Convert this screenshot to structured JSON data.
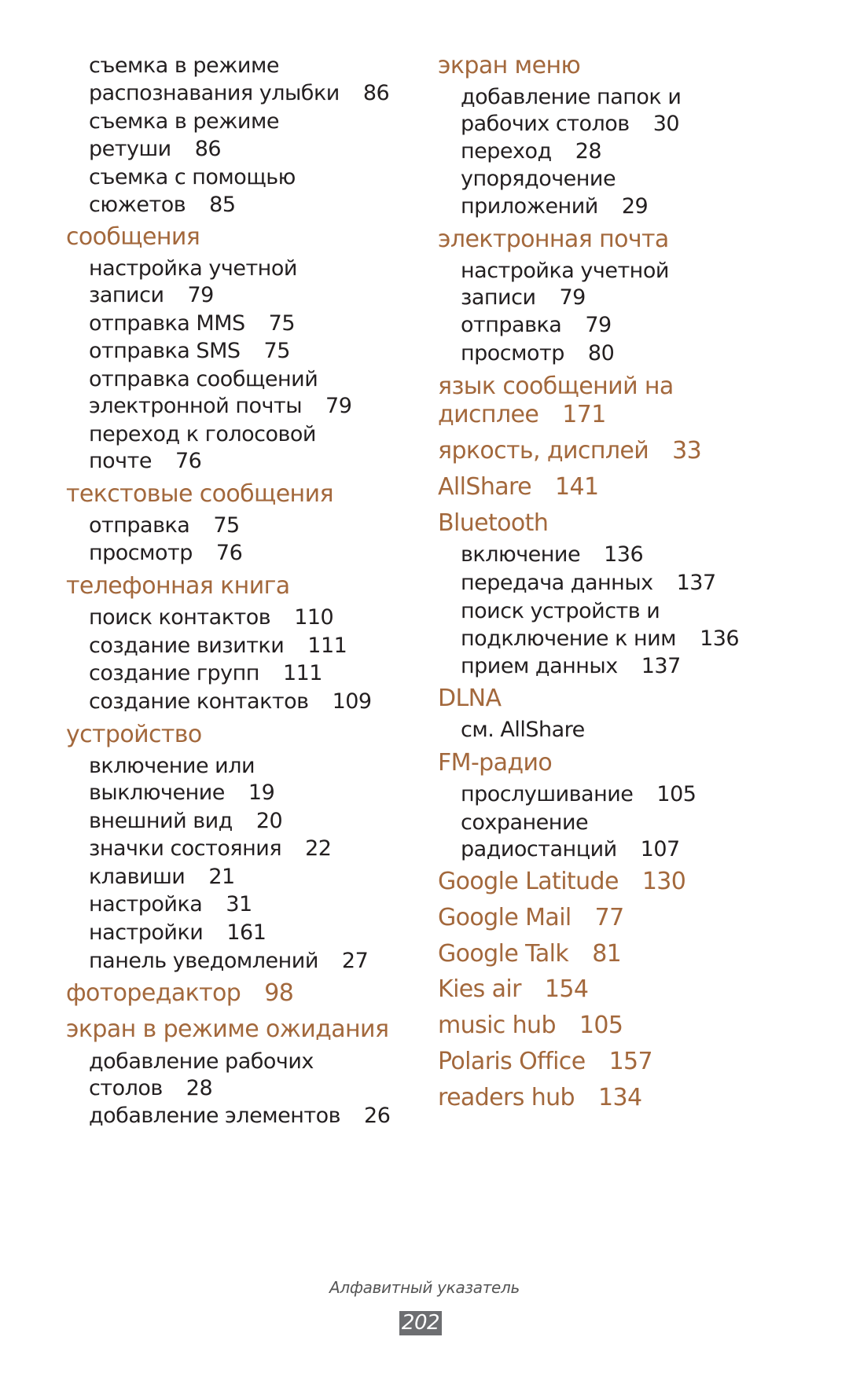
{
  "colors": {
    "heading": "#a3683c",
    "body": "#231f20",
    "footer": "#555555",
    "page_badge": "#6d6e71"
  },
  "left_column": [
    {
      "type": "sub",
      "text": "съемка в режиме",
      "page": ""
    },
    {
      "type": "sub",
      "text": "распознавания улыбки",
      "page": "86"
    },
    {
      "type": "sub",
      "text": "съемка в режиме",
      "page": ""
    },
    {
      "type": "sub",
      "text": "ретуши",
      "page": "86"
    },
    {
      "type": "sub",
      "text": "съемка с помощью",
      "page": ""
    },
    {
      "type": "sub",
      "text": "сюжетов",
      "page": "85"
    },
    {
      "type": "head",
      "text": "сообщения",
      "page": ""
    },
    {
      "type": "sub",
      "text": "настройка учетной",
      "page": ""
    },
    {
      "type": "sub",
      "text": "записи",
      "page": "79"
    },
    {
      "type": "sub",
      "text": "отправка MMS",
      "page": "75"
    },
    {
      "type": "sub",
      "text": "отправка SMS",
      "page": "75"
    },
    {
      "type": "sub",
      "text": "отправка сообщений",
      "page": ""
    },
    {
      "type": "sub",
      "text": "электронной почты",
      "page": "79"
    },
    {
      "type": "sub",
      "text": "переход к голосовой",
      "page": ""
    },
    {
      "type": "sub",
      "text": "почте",
      "page": "76"
    },
    {
      "type": "head",
      "text": "текстовые сообщения",
      "page": ""
    },
    {
      "type": "sub",
      "text": "отправка",
      "page": "75"
    },
    {
      "type": "sub",
      "text": "просмотр",
      "page": "76"
    },
    {
      "type": "head",
      "text": "телефонная книга",
      "page": ""
    },
    {
      "type": "sub",
      "text": "поиск контактов",
      "page": "110"
    },
    {
      "type": "sub",
      "text": "создание визитки",
      "page": "111"
    },
    {
      "type": "sub",
      "text": "создание групп",
      "page": "111"
    },
    {
      "type": "sub",
      "text": "создание контактов",
      "page": "109"
    },
    {
      "type": "head",
      "text": "устройство",
      "page": ""
    },
    {
      "type": "sub",
      "text": "включение или",
      "page": ""
    },
    {
      "type": "sub",
      "text": "выключение",
      "page": "19"
    },
    {
      "type": "sub",
      "text": "внешний вид",
      "page": "20"
    },
    {
      "type": "sub",
      "text": "значки состояния",
      "page": "22"
    },
    {
      "type": "sub",
      "text": "клавиши",
      "page": "21"
    },
    {
      "type": "sub",
      "text": "настройка",
      "page": "31"
    },
    {
      "type": "sub",
      "text": "настройки",
      "page": "161"
    },
    {
      "type": "sub",
      "text": "панель уведомлений",
      "page": "27"
    },
    {
      "type": "head",
      "text": "фоторедактор",
      "page": "98"
    },
    {
      "type": "head",
      "text": "экран в режиме ожидания",
      "page": ""
    },
    {
      "type": "sub",
      "text": "добавление рабочих",
      "page": ""
    },
    {
      "type": "sub",
      "text": "столов",
      "page": "28"
    },
    {
      "type": "sub",
      "text": "добавление элементов",
      "page": "26"
    }
  ],
  "right_column": [
    {
      "type": "head",
      "text": "экран меню",
      "page": ""
    },
    {
      "type": "sub",
      "text": "добавление папок и",
      "page": ""
    },
    {
      "type": "sub",
      "text": "рабочих столов",
      "page": "30"
    },
    {
      "type": "sub",
      "text": "переход",
      "page": "28"
    },
    {
      "type": "sub",
      "text": "упорядочение",
      "page": ""
    },
    {
      "type": "sub",
      "text": "приложений",
      "page": "29"
    },
    {
      "type": "head",
      "text": "электронная почта",
      "page": ""
    },
    {
      "type": "sub",
      "text": "настройка учетной",
      "page": ""
    },
    {
      "type": "sub",
      "text": "записи",
      "page": "79"
    },
    {
      "type": "sub",
      "text": "отправка",
      "page": "79"
    },
    {
      "type": "sub",
      "text": "просмотр",
      "page": "80"
    },
    {
      "type": "head",
      "text": "язык сообщений на",
      "page": ""
    },
    {
      "type": "head",
      "text": "дисплее",
      "page": "171"
    },
    {
      "type": "head",
      "text": "яркость, дисплей",
      "page": "33"
    },
    {
      "type": "head",
      "text": "AllShare",
      "page": "141"
    },
    {
      "type": "head",
      "text": "Bluetooth",
      "page": ""
    },
    {
      "type": "sub",
      "text": "включение",
      "page": "136"
    },
    {
      "type": "sub",
      "text": "передача данных",
      "page": "137"
    },
    {
      "type": "sub",
      "text": "поиск устройств и",
      "page": ""
    },
    {
      "type": "sub",
      "text": "подключение к ним",
      "page": "136"
    },
    {
      "type": "sub",
      "text": "прием данных",
      "page": "137"
    },
    {
      "type": "head",
      "text": "DLNA",
      "page": ""
    },
    {
      "type": "sub",
      "text": "см. AllShare",
      "page": ""
    },
    {
      "type": "head",
      "text": "FM-радио",
      "page": ""
    },
    {
      "type": "sub",
      "text": "прослушивание",
      "page": "105"
    },
    {
      "type": "sub",
      "text": "сохранение",
      "page": ""
    },
    {
      "type": "sub",
      "text": "радиостанций",
      "page": "107"
    },
    {
      "type": "head",
      "text": "Google Latitude",
      "page": "130"
    },
    {
      "type": "head",
      "text": "Google Mail",
      "page": "77"
    },
    {
      "type": "head",
      "text": "Google Talk",
      "page": "81"
    },
    {
      "type": "head",
      "text": "Kies air",
      "page": "154"
    },
    {
      "type": "head",
      "text": "music hub",
      "page": "105"
    },
    {
      "type": "head",
      "text": "Polaris Office",
      "page": "157"
    },
    {
      "type": "head",
      "text": "readers hub",
      "page": "134"
    }
  ],
  "footer": {
    "section_title": "Алфавитный указатель",
    "page_number": "202"
  }
}
